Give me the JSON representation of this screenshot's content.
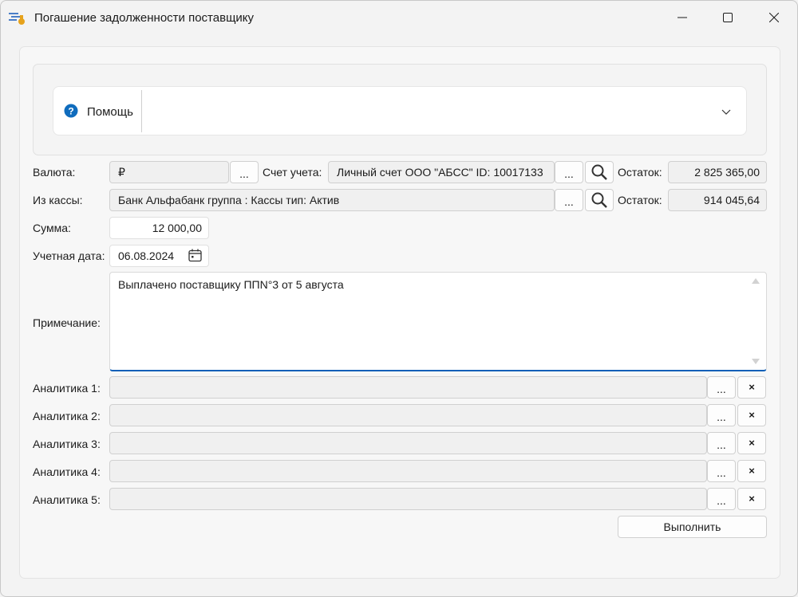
{
  "window": {
    "title": "Погашение задолженности поставщику"
  },
  "help": {
    "label": "Помощь"
  },
  "form": {
    "currency_label": "Валюта:",
    "currency_value": "₽",
    "account_label": "Счет учета:",
    "account_value": "Личный счет ООО \"АБСС\" ID: 10017133",
    "balance_label": "Остаток:",
    "account_balance": "2 825 365,00",
    "cashbox_label": "Из кассы:",
    "cashbox_value": "Банк Альфабанк  группа : Кассы тип: Актив",
    "cashbox_balance": "914 045,64",
    "sum_label": "Сумма:",
    "sum_value": "12 000,00",
    "date_label": "Учетная дата:",
    "date_value": "06.08.2024",
    "note_label": "Примечание:",
    "note_value": "Выплачено поставщику ППN°3 от 5 августа",
    "analytics": [
      {
        "label": "Аналитика 1:",
        "value": ""
      },
      {
        "label": "Аналитика 2:",
        "value": ""
      },
      {
        "label": "Аналитика 3:",
        "value": ""
      },
      {
        "label": "Аналитика 4:",
        "value": ""
      },
      {
        "label": "Аналитика 5:",
        "value": ""
      }
    ],
    "dots_label": "...",
    "clear_label": "×",
    "execute_label": "Выполнить"
  },
  "colors": {
    "accent": "#0f5fb8",
    "help_icon": "#0f6cbd"
  },
  "icons": [
    "app-icon",
    "minimize-icon",
    "maximize-icon",
    "close-icon",
    "help-icon",
    "chevron-down-icon",
    "search-icon",
    "calendar-icon"
  ]
}
